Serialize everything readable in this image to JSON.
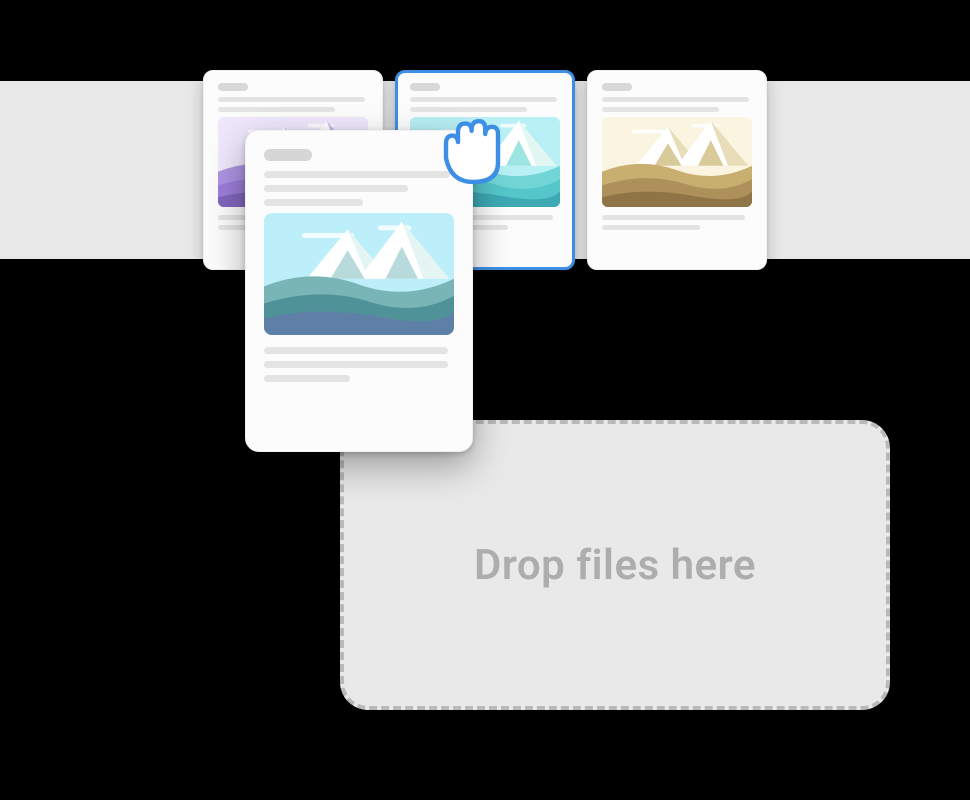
{
  "accent": "#3D8FE5",
  "cards": [
    {
      "palette": "purple",
      "selected": false
    },
    {
      "palette": "cyan",
      "selected": true
    },
    {
      "palette": "gold",
      "selected": false
    }
  ],
  "dragged_card": {
    "palette": "teal"
  },
  "dropzone": {
    "label": "Drop files here"
  },
  "palettes": {
    "purple": {
      "sky": "#EFE8FC",
      "snow": "#FFFFFF",
      "shade": "#C8B6ED",
      "rock": "#B7A6DD",
      "hill1": "#AD94E3",
      "hill2": "#9C7ED9",
      "hill3": "#8166BE"
    },
    "cyan": {
      "sky": "#B8F0F5",
      "snow": "#FFFFFF",
      "shade": "#E2F7F2",
      "rock": "#9DE5E0",
      "hill1": "#73D6D6",
      "hill2": "#55C6CA",
      "hill3": "#3DA9B3"
    },
    "gold": {
      "sky": "#FBF4E1",
      "snow": "#FFFFFF",
      "shade": "#E8DDB9",
      "rock": "#D9CA9A",
      "hill1": "#C8AE6F",
      "hill2": "#AE915A",
      "hill3": "#8F7545"
    },
    "teal": {
      "sky": "#BDEFFA",
      "snow": "#FFFFFF",
      "shade": "#E4F5F3",
      "rock": "#B8DADC",
      "hill1": "#79B4B7",
      "hill2": "#4F9398",
      "hill3": "#5E7FA6"
    }
  }
}
